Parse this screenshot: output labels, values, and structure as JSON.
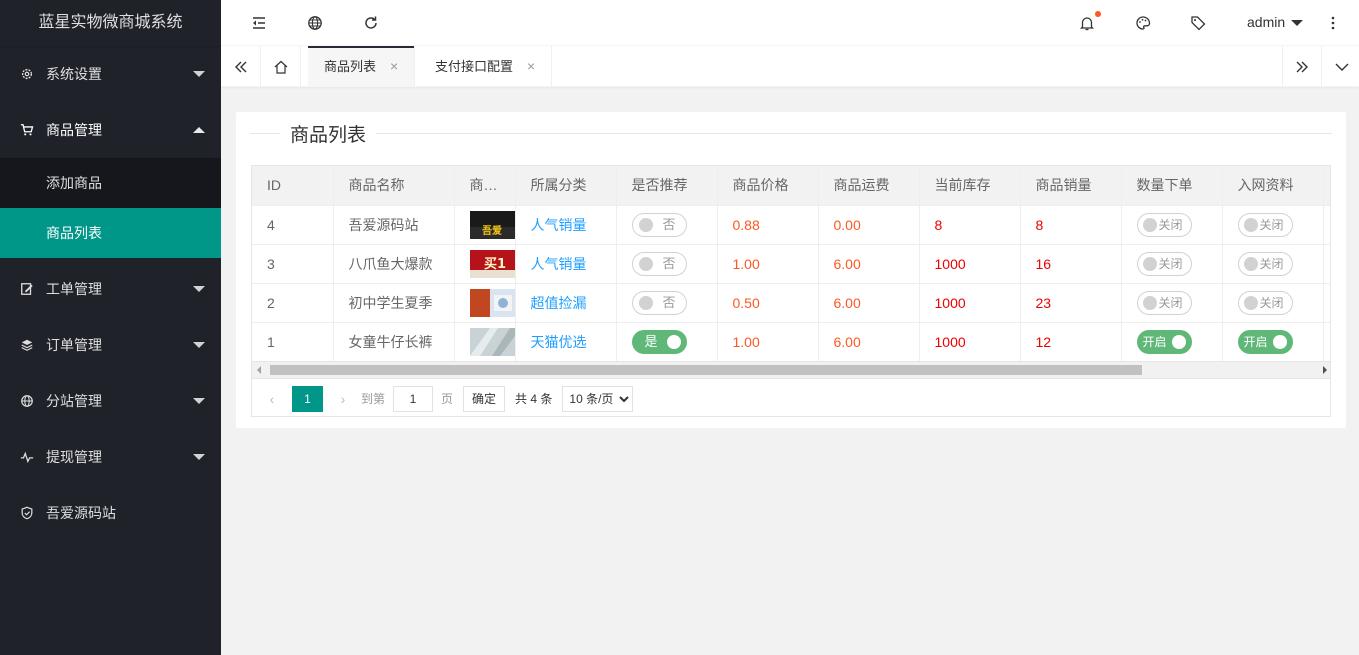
{
  "app": {
    "title": "蓝星实物微商城系统"
  },
  "sidebar": {
    "items": [
      {
        "label": "系统设置",
        "icon": "gear-icon"
      },
      {
        "label": "商品管理",
        "icon": "cart-icon",
        "sub": [
          "添加商品",
          "商品列表"
        ]
      },
      {
        "label": "工单管理",
        "icon": "edit-doc-icon"
      },
      {
        "label": "订单管理",
        "icon": "layers-icon"
      },
      {
        "label": "分站管理",
        "icon": "globe-icon"
      },
      {
        "label": "提现管理",
        "icon": "pulse-icon"
      },
      {
        "label": "吾爱源码站",
        "icon": "shield-check-icon"
      }
    ]
  },
  "header": {
    "user": "admin"
  },
  "tabs": [
    {
      "label": "商品列表"
    },
    {
      "label": "支付接口配置"
    }
  ],
  "card": {
    "title": "商品列表"
  },
  "table": {
    "columns": [
      "ID",
      "商品名称",
      "商品图片",
      "所属分类",
      "是否推荐",
      "商品价格",
      "商品运费",
      "当前库存",
      "商品销量",
      "数量下单",
      "入网资料"
    ],
    "rows": [
      {
        "id": "4",
        "name": "吾爱源码站",
        "thumb_text": "吾爱",
        "category": "人气销量",
        "recommend": "否",
        "recommend_on": false,
        "price": "0.88",
        "shipping": "0.00",
        "stock": "8",
        "sales": "8",
        "qty_order": "关闭",
        "qty_on": false,
        "netinfo": "关闭",
        "net_on": false
      },
      {
        "id": "3",
        "name": "八爪鱼大爆款",
        "thumb_text": "买1",
        "category": "人气销量",
        "recommend": "否",
        "recommend_on": false,
        "price": "1.00",
        "shipping": "6.00",
        "stock": "1000",
        "sales": "16",
        "qty_order": "关闭",
        "qty_on": false,
        "netinfo": "关闭",
        "net_on": false
      },
      {
        "id": "2",
        "name": "初中学生夏季",
        "thumb_text": "",
        "category": "超值捡漏",
        "recommend": "否",
        "recommend_on": false,
        "price": "0.50",
        "shipping": "6.00",
        "stock": "1000",
        "sales": "23",
        "qty_order": "关闭",
        "qty_on": false,
        "netinfo": "关闭",
        "net_on": false
      },
      {
        "id": "1",
        "name": "女童牛仔长裤",
        "thumb_text": "",
        "category": "天猫优选",
        "recommend": "是",
        "recommend_on": true,
        "price": "1.00",
        "shipping": "6.00",
        "stock": "1000",
        "sales": "12",
        "qty_order": "开启",
        "qty_on": true,
        "netinfo": "开启",
        "net_on": true
      }
    ]
  },
  "pager": {
    "current": "1",
    "goto_label": "到第",
    "goto_value": "1",
    "page_label": "页",
    "confirm": "确定",
    "total": "共 4 条",
    "page_size": "10 条/页"
  }
}
